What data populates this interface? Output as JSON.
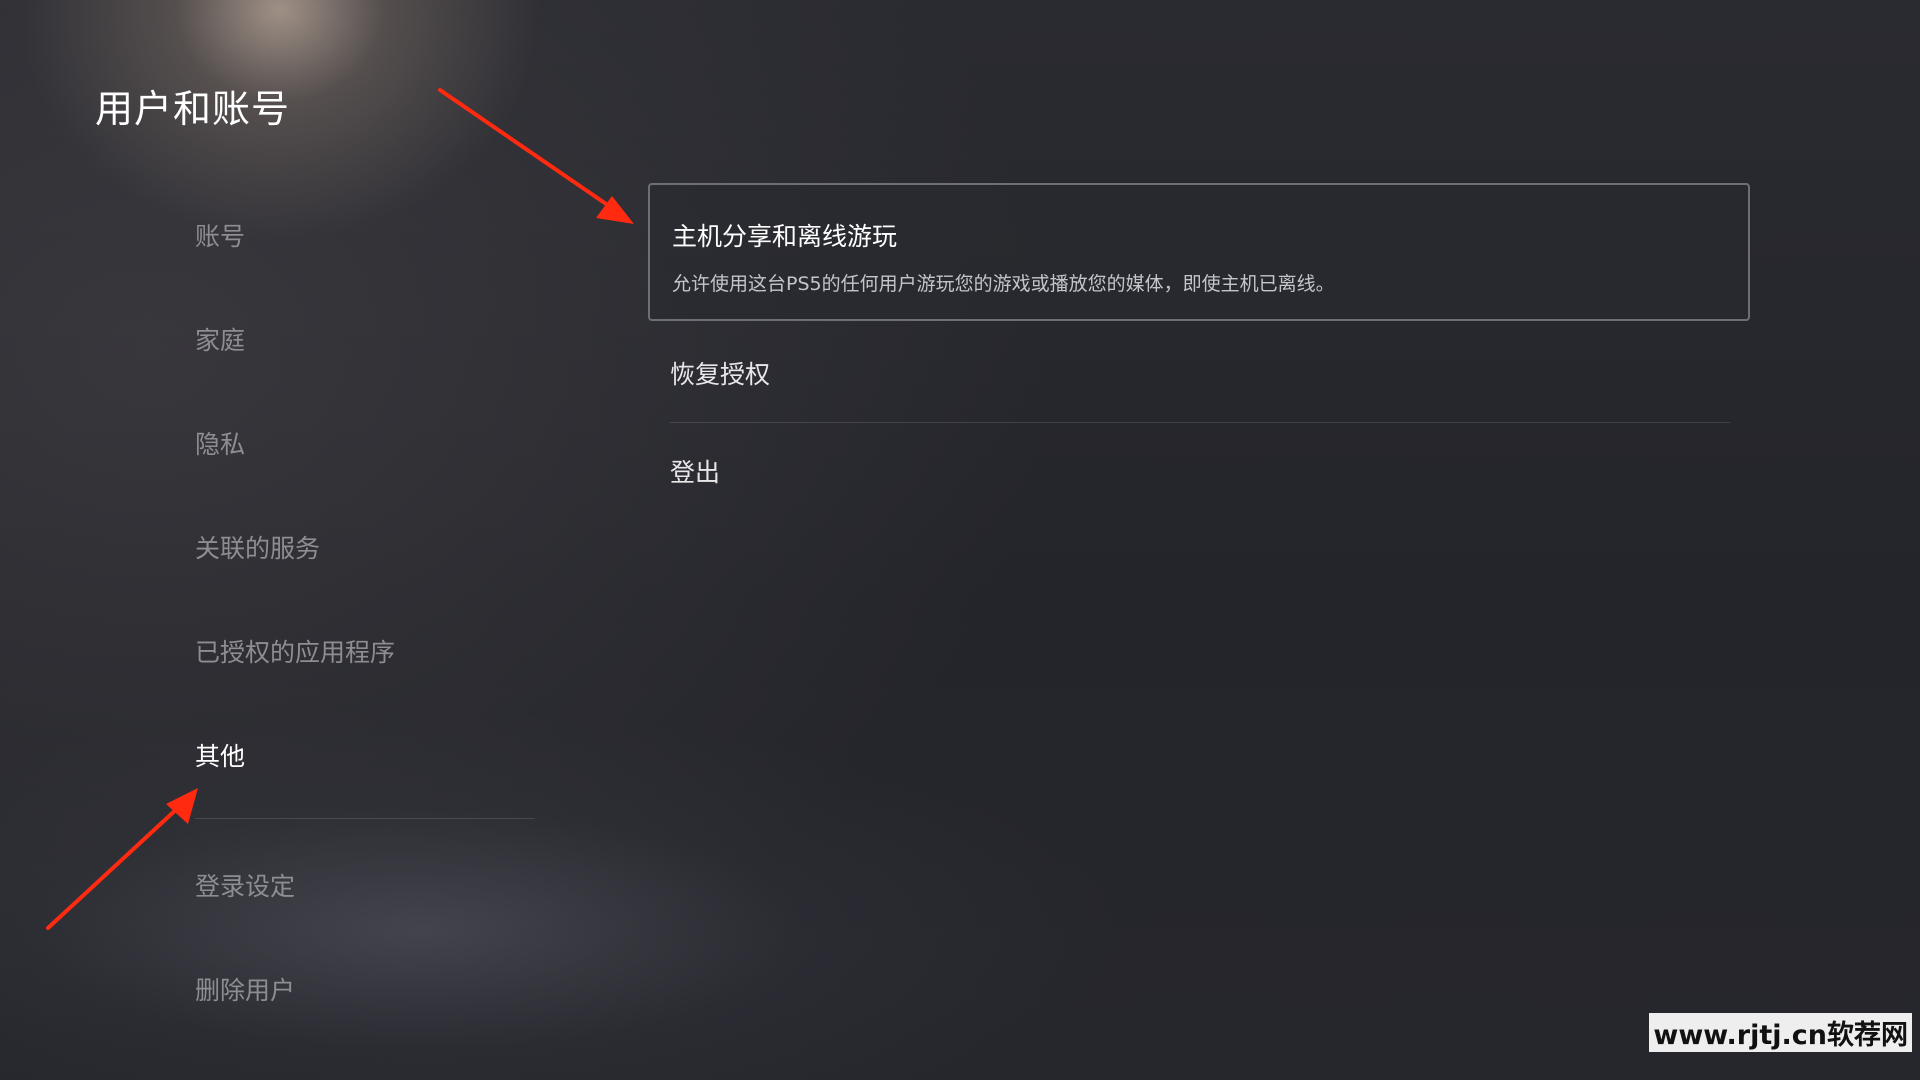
{
  "header": {
    "title": "用户和账号"
  },
  "sidebar": {
    "items": [
      {
        "label": "账号"
      },
      {
        "label": "家庭"
      },
      {
        "label": "隐私"
      },
      {
        "label": "关联的服务"
      },
      {
        "label": "已授权的应用程序"
      },
      {
        "label": "其他",
        "active": true
      },
      {
        "label": "登录设定"
      },
      {
        "label": "删除用户"
      }
    ]
  },
  "main": {
    "options": [
      {
        "title": "主机分享和离线游玩",
        "description": "允许使用这台PS5的任何用户游玩您的游戏或播放您的媒体，即使主机已离线。"
      },
      {
        "title": "恢复授权"
      },
      {
        "title": "登出"
      }
    ]
  },
  "annotations": {
    "arrow_color": "#ff2a10"
  },
  "watermark": {
    "text": "www.rjtj.cn软荐网"
  },
  "colors": {
    "background": "#24252b",
    "active_text": "#ffffff",
    "inactive_text": "#8d8d92",
    "card_border": "#6c6f78"
  }
}
